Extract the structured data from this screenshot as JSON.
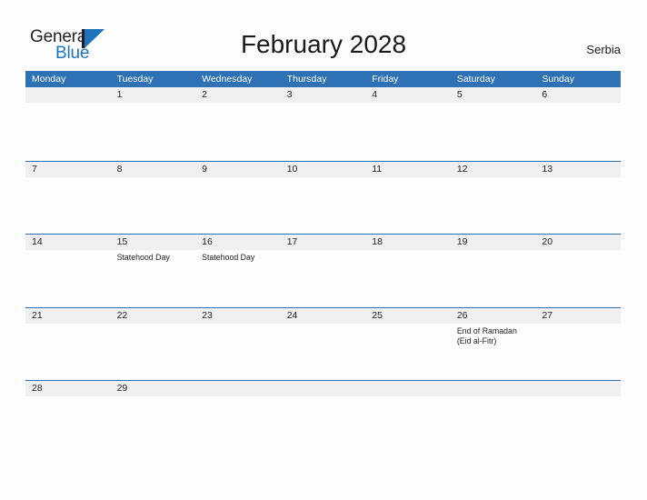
{
  "logo": {
    "word1": "General",
    "word2": "Blue",
    "mark": "blue-triangle"
  },
  "header": {
    "title": "February 2028",
    "country": "Serbia"
  },
  "calendar": {
    "weekday_headers": [
      "Monday",
      "Tuesday",
      "Wednesday",
      "Thursday",
      "Friday",
      "Saturday",
      "Sunday"
    ],
    "weeks": [
      [
        {
          "date": "",
          "events": []
        },
        {
          "date": "1",
          "events": []
        },
        {
          "date": "2",
          "events": []
        },
        {
          "date": "3",
          "events": []
        },
        {
          "date": "4",
          "events": []
        },
        {
          "date": "5",
          "events": []
        },
        {
          "date": "6",
          "events": []
        }
      ],
      [
        {
          "date": "7",
          "events": []
        },
        {
          "date": "8",
          "events": []
        },
        {
          "date": "9",
          "events": []
        },
        {
          "date": "10",
          "events": []
        },
        {
          "date": "11",
          "events": []
        },
        {
          "date": "12",
          "events": []
        },
        {
          "date": "13",
          "events": []
        }
      ],
      [
        {
          "date": "14",
          "events": []
        },
        {
          "date": "15",
          "events": [
            "Statehood Day"
          ]
        },
        {
          "date": "16",
          "events": [
            "Statehood Day"
          ]
        },
        {
          "date": "17",
          "events": []
        },
        {
          "date": "18",
          "events": []
        },
        {
          "date": "19",
          "events": []
        },
        {
          "date": "20",
          "events": []
        }
      ],
      [
        {
          "date": "21",
          "events": []
        },
        {
          "date": "22",
          "events": []
        },
        {
          "date": "23",
          "events": []
        },
        {
          "date": "24",
          "events": []
        },
        {
          "date": "25",
          "events": []
        },
        {
          "date": "26",
          "events": [
            "End of Ramadan",
            "(Eid al-Fitr)"
          ]
        },
        {
          "date": "27",
          "events": []
        }
      ],
      [
        {
          "date": "28",
          "events": []
        },
        {
          "date": "29",
          "events": []
        },
        {
          "date": "",
          "events": []
        },
        {
          "date": "",
          "events": []
        },
        {
          "date": "",
          "events": []
        },
        {
          "date": "",
          "events": []
        },
        {
          "date": "",
          "events": []
        }
      ]
    ]
  },
  "colors": {
    "header_blue": "#2e72b5",
    "band_gray": "#f0f0f0",
    "logo_blue": "#1d74bd",
    "text": "#222222",
    "page_bg": "#fdfdfd"
  }
}
